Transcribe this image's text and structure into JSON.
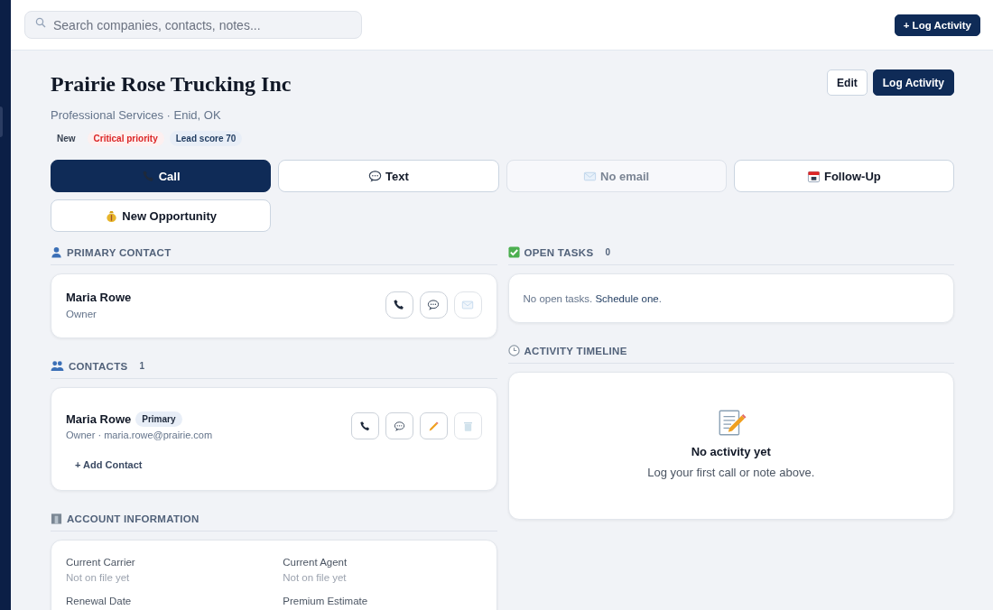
{
  "search": {
    "placeholder": "Search companies, contacts, notes..."
  },
  "top_button": "+ Log Activity",
  "company": {
    "name": "Prairie Rose Trucking Inc",
    "subtitle": "Professional Services · Enid, OK"
  },
  "header_buttons": [
    {
      "label": "Edit",
      "primary": false
    },
    {
      "label": "Log Activity",
      "primary": true
    }
  ],
  "badges": [
    {
      "label": "New",
      "kind": "status"
    },
    {
      "label": "Critical priority",
      "kind": "priority"
    },
    {
      "label": "Lead score 70",
      "kind": "score"
    }
  ],
  "actions": [
    {
      "label": "Call",
      "kind": "phone",
      "primary": true,
      "disabled": false
    },
    {
      "label": "Text",
      "kind": "chat",
      "primary": false,
      "disabled": false
    },
    {
      "label": "No email",
      "kind": "mail",
      "primary": false,
      "disabled": true
    },
    {
      "label": "Follow-Up",
      "kind": "calendar",
      "primary": false,
      "disabled": false
    },
    {
      "label": "New Opportunity",
      "kind": "money",
      "primary": false,
      "disabled": false
    }
  ],
  "primary_contact": {
    "heading": "PRIMARY CONTACT",
    "name": "Maria Rowe",
    "role": "Owner",
    "buttons": [
      {
        "kind": "phone",
        "disabled": false
      },
      {
        "kind": "chat",
        "disabled": false
      },
      {
        "kind": "mail",
        "disabled": true
      }
    ]
  },
  "contacts": {
    "heading": "CONTACTS",
    "count": "1",
    "items": [
      {
        "name": "Maria Rowe",
        "tag": "Primary",
        "detail": "Owner · maria.rowe@prairie.com",
        "buttons": [
          {
            "kind": "phone",
            "disabled": false
          },
          {
            "kind": "chat",
            "disabled": false
          },
          {
            "kind": "pencil",
            "disabled": false
          },
          {
            "kind": "trash",
            "disabled": true
          }
        ]
      }
    ],
    "add_label": "+ Add Contact"
  },
  "account": {
    "heading": "ACCOUNT INFORMATION",
    "fields": [
      {
        "label": "Current Carrier",
        "value": "Not on file yet"
      },
      {
        "label": "Current Agent",
        "value": "Not on file yet"
      },
      {
        "label": "Renewal Date"
      },
      {
        "label": "Premium Estimate"
      }
    ]
  },
  "tasks": {
    "heading": "OPEN TASKS",
    "count": "0",
    "empty_text": "No open tasks.",
    "link": "Schedule one",
    "after": "."
  },
  "timeline": {
    "heading": "ACTIVITY TIMELINE",
    "empty_title": "No activity yet",
    "empty_text": "Log your first call or note above."
  }
}
